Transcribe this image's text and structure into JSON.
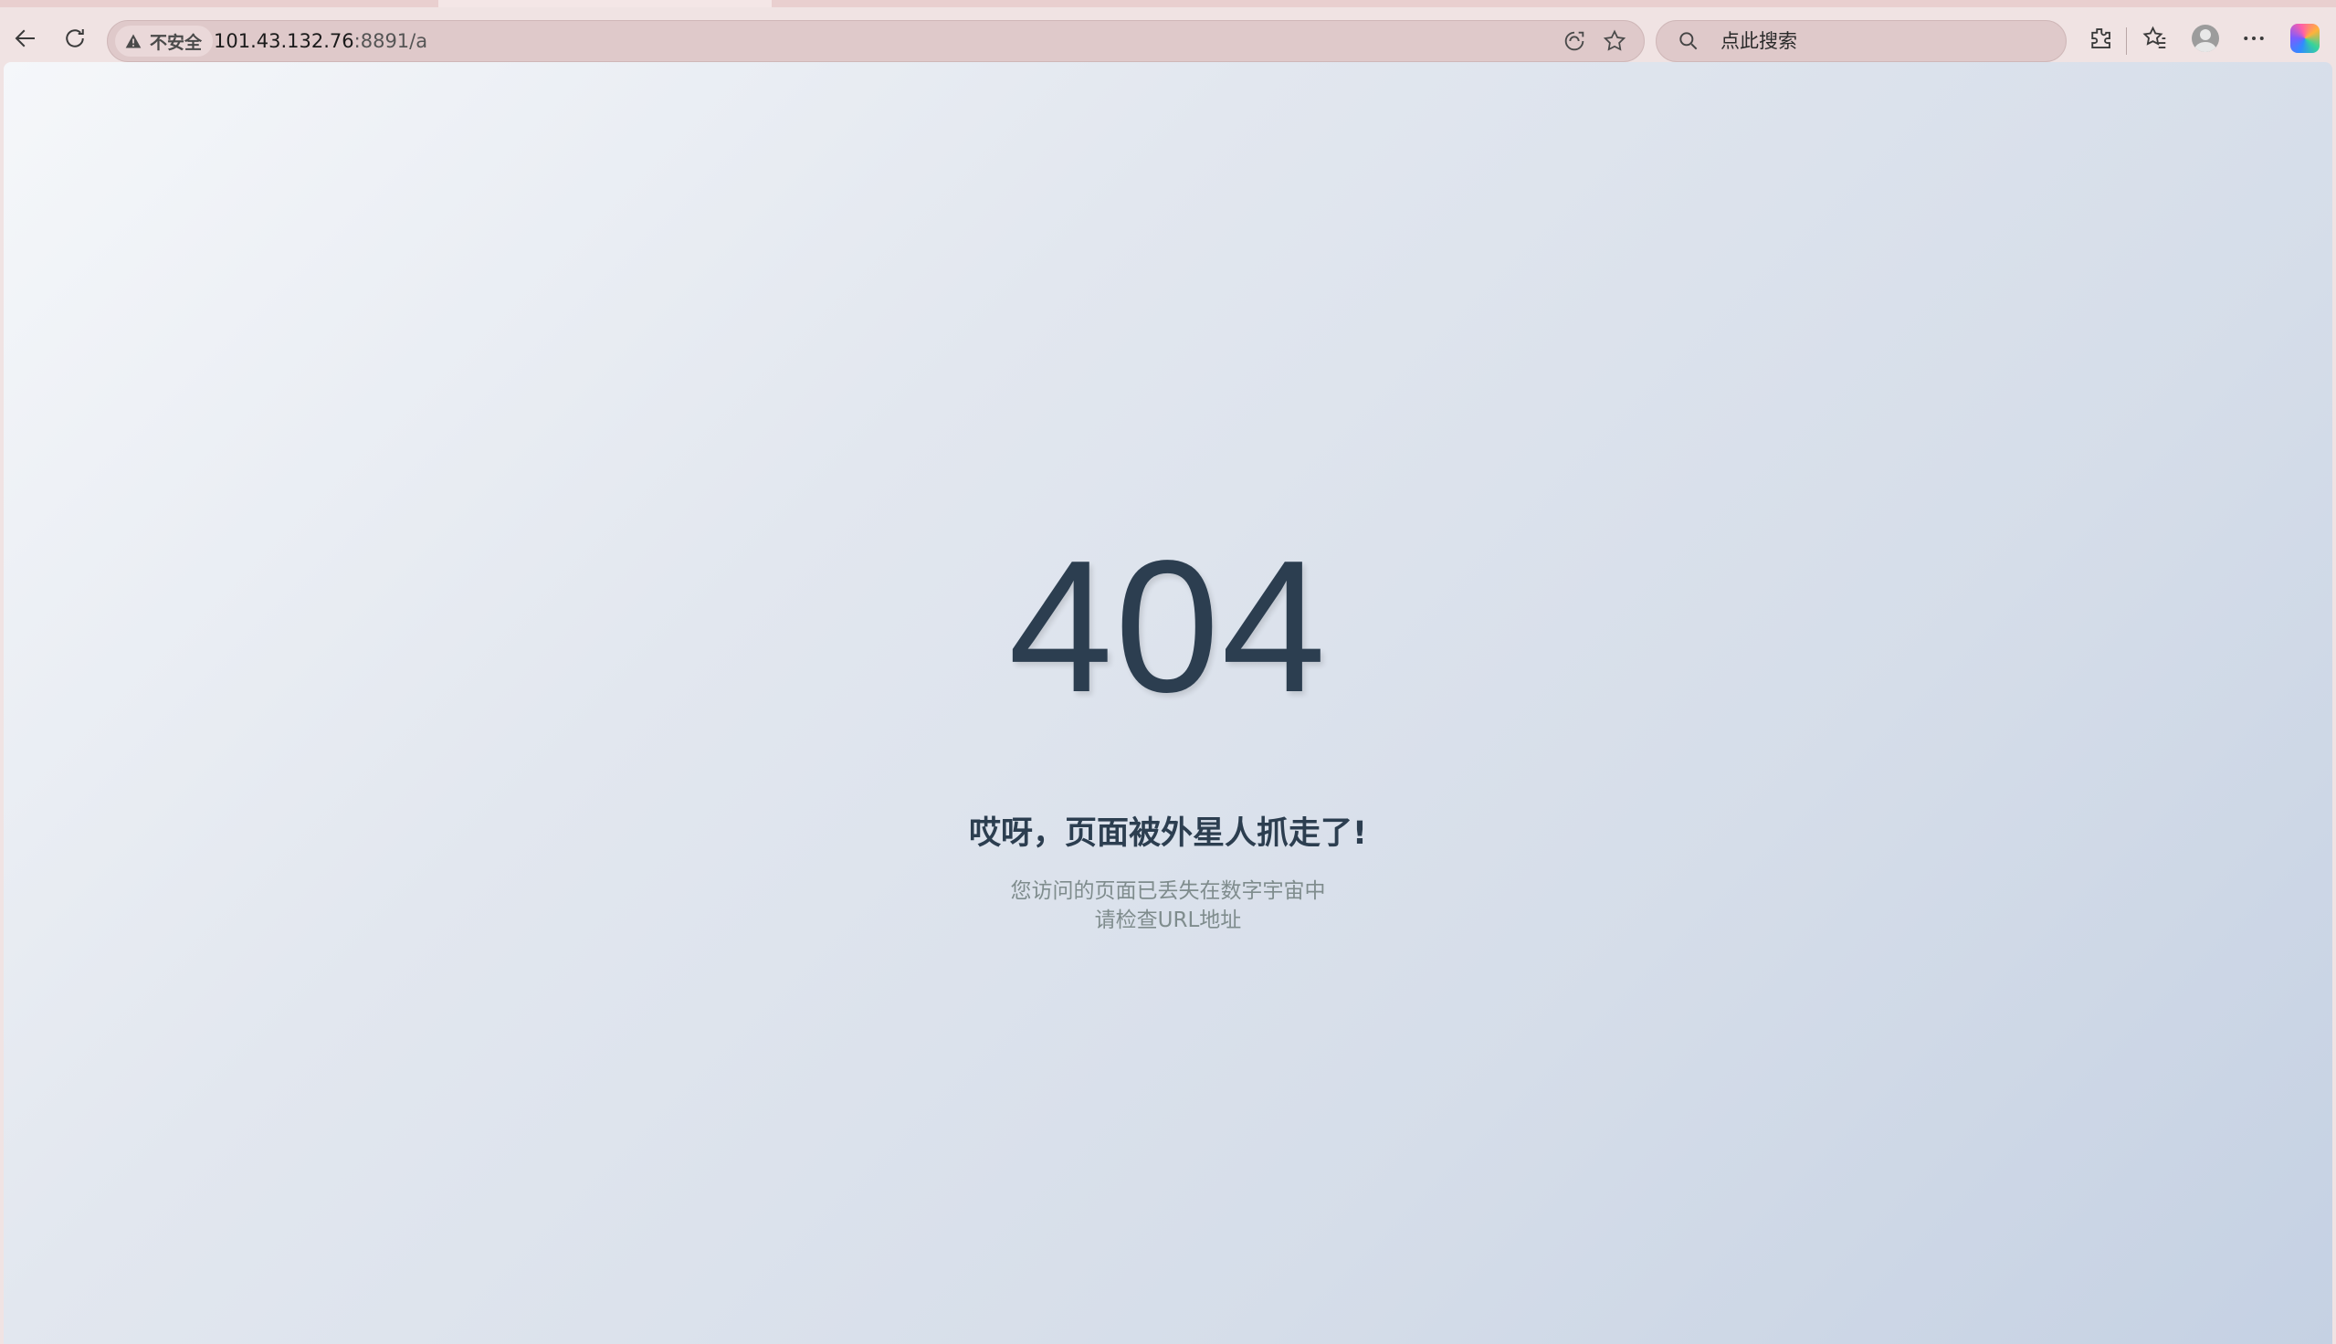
{
  "browser": {
    "security_label": "不安全",
    "url_host": "101.43.132.76",
    "url_rest": ":8891/a",
    "search_placeholder": "点此搜索"
  },
  "page": {
    "error_code": "404",
    "title": "哎呀，页面被外星人抓走了!",
    "description_line1": "您访问的页面已丢失在数字宇宙中",
    "description_line2": "请检查URL地址"
  },
  "colors": {
    "heading": "#2c3e50",
    "muted": "#7f8c8d",
    "chrome": "#f0e3e3"
  },
  "icons": [
    "back-arrow-icon",
    "refresh-icon",
    "warning-icon",
    "read-aloud-icon",
    "star-icon",
    "search-icon",
    "extensions-icon",
    "favorites-icon",
    "profile-icon",
    "more-icon",
    "copilot-icon"
  ]
}
